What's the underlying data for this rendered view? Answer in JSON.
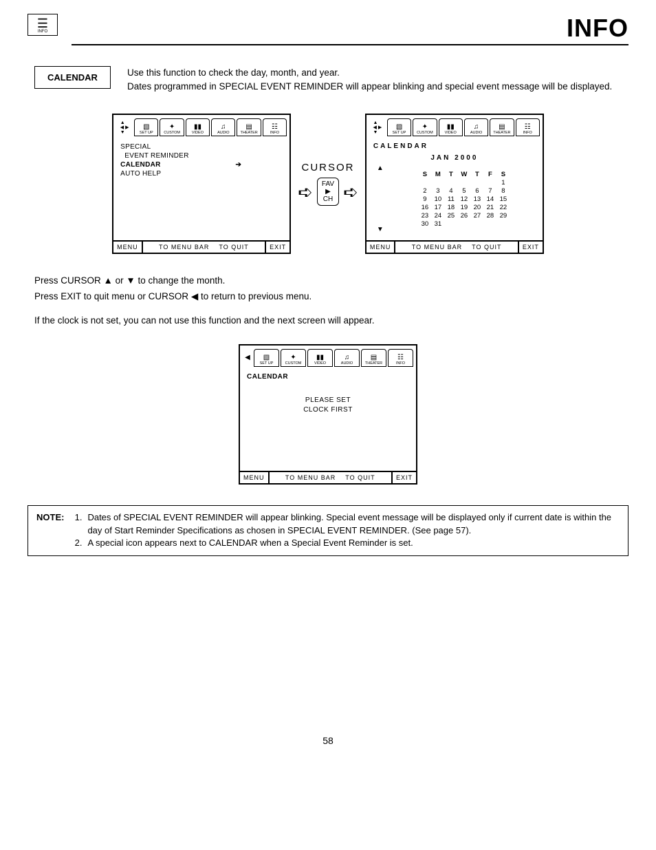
{
  "header": {
    "icon_label": "INFO",
    "title": "INFO"
  },
  "section_label": "CALENDAR",
  "intro": {
    "line1": "Use this function to check the day, month, and year.",
    "line2": "Dates programmed in SPECIAL EVENT REMINDER will appear blinking and special event message will be displayed."
  },
  "tabs": [
    "SET UP",
    "CUSTOM",
    "VIDEO",
    "AUDIO",
    "THEATER",
    "INFO"
  ],
  "screen1": {
    "items": [
      {
        "label": "SPECIAL",
        "sel": false
      },
      {
        "label": "  EVENT REMINDER",
        "sel": false
      },
      {
        "label": "CALENDAR",
        "sel": true,
        "arrow": true
      },
      {
        "label": "AUTO HELP",
        "sel": false
      }
    ],
    "footer": {
      "menu": "MENU",
      "toMenuBar": "TO MENU BAR",
      "toQuit": "TO QUIT",
      "exit": "EXIT"
    }
  },
  "cursor": {
    "label": "CURSOR",
    "fav": "FAV",
    "ch": "CH"
  },
  "screen2": {
    "title": "CALENDAR",
    "month": "JAN 2000",
    "dow": [
      "S",
      "M",
      "T",
      "W",
      "T",
      "F",
      "S"
    ],
    "weeks": [
      [
        "",
        "",
        "",
        "",
        "",
        "",
        "1"
      ],
      [
        "2",
        "3",
        "4",
        "5",
        "6",
        "7",
        "8"
      ],
      [
        "9",
        "10",
        "11",
        "12",
        "13",
        "14",
        "15"
      ],
      [
        "16",
        "17",
        "18",
        "19",
        "20",
        "21",
        "22"
      ],
      [
        "23",
        "24",
        "25",
        "26",
        "27",
        "28",
        "29"
      ],
      [
        "30",
        "31",
        "",
        "",
        "",
        "",
        ""
      ]
    ],
    "footer": {
      "menu": "MENU",
      "toMenuBar": "TO MENU BAR",
      "toQuit": "TO QUIT",
      "exit": "EXIT"
    }
  },
  "instructions": {
    "p1": "Press CURSOR ▲ or ▼ to change the month.",
    "p2": "Press EXIT to quit menu or CURSOR ◀ to return to previous menu.",
    "p3": "If the clock is not set, you can not use this function and the next screen will appear."
  },
  "screen3": {
    "title": "CALENDAR",
    "msg1": "PLEASE SET",
    "msg2": "CLOCK FIRST",
    "footer": {
      "menu": "MENU",
      "toMenuBar": "TO MENU BAR",
      "toQuit": "TO QUIT",
      "exit": "EXIT"
    }
  },
  "note": {
    "label": "NOTE:",
    "n1_num": "1.",
    "n1": "Dates of SPECIAL EVENT REMINDER will appear blinking.  Special event message will be displayed only if current date is within the day of Start Reminder Specifications as chosen in SPECIAL EVENT REMINDER. (See page 57).",
    "n2_num": "2.",
    "n2": "A special icon appears next to  CALENDAR  when a Special Event Reminder is set."
  },
  "page_number": "58"
}
